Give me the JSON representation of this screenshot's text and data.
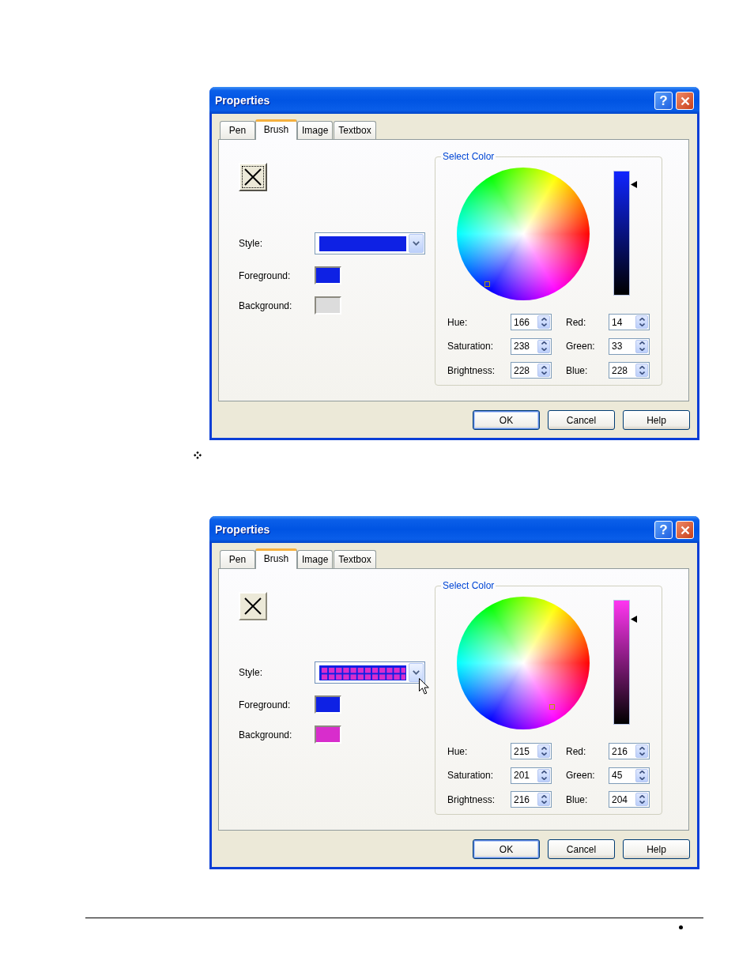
{
  "dialogs": [
    {
      "title": "Properties",
      "title_buttons": [
        {
          "kind": "help",
          "label": "?"
        },
        {
          "kind": "close"
        }
      ],
      "tabs": [
        {
          "label": "Pen",
          "selected": false
        },
        {
          "label": "Brush",
          "selected": true
        },
        {
          "label": "Image",
          "selected": false
        },
        {
          "label": "Textbox",
          "selected": false
        }
      ],
      "brush": {
        "clear_button": {
          "focused": true
        },
        "style": {
          "label": "Style:",
          "grid_pattern": false,
          "hovered": false
        },
        "foreground": {
          "label": "Foreground:",
          "color": "#0e21e4"
        },
        "background": {
          "label": "Background:",
          "color": "#dcdcdc"
        }
      },
      "select_color": {
        "title": "Select Color",
        "hsb": [
          {
            "label": "Hue:",
            "value": "166"
          },
          {
            "label": "Saturation:",
            "value": "238"
          },
          {
            "label": "Brightness:",
            "value": "228"
          }
        ],
        "rgb": [
          {
            "label": "Red:",
            "value": "14"
          },
          {
            "label": "Green:",
            "value": "33"
          },
          {
            "label": "Blue:",
            "value": "228"
          }
        ]
      },
      "buttons": [
        {
          "label": "OK",
          "default": true
        },
        {
          "label": "Cancel",
          "default": false
        },
        {
          "label": "Help",
          "default": false
        }
      ]
    },
    {
      "title": "Properties",
      "title_buttons": [
        {
          "kind": "help",
          "label": "?"
        },
        {
          "kind": "close"
        }
      ],
      "tabs": [
        {
          "label": "Pen",
          "selected": false
        },
        {
          "label": "Brush",
          "selected": true
        },
        {
          "label": "Image",
          "selected": false
        },
        {
          "label": "Textbox",
          "selected": false
        }
      ],
      "brush": {
        "clear_button": {
          "focused": false
        },
        "style": {
          "label": "Style:",
          "grid_pattern": true,
          "hovered": true
        },
        "foreground": {
          "label": "Foreground:",
          "color": "#0e21e4"
        },
        "background": {
          "label": "Background:",
          "color": "#d82dcc"
        }
      },
      "select_color": {
        "title": "Select Color",
        "hsb": [
          {
            "label": "Hue:",
            "value": "215"
          },
          {
            "label": "Saturation:",
            "value": "201"
          },
          {
            "label": "Brightness:",
            "value": "216"
          }
        ],
        "rgb": [
          {
            "label": "Red:",
            "value": "216"
          },
          {
            "label": "Green:",
            "value": "45"
          },
          {
            "label": "Blue:",
            "value": "204"
          }
        ]
      },
      "buttons": [
        {
          "label": "OK",
          "default": true
        },
        {
          "label": "Cancel",
          "default": false
        },
        {
          "label": "Help",
          "default": false
        }
      ]
    }
  ]
}
